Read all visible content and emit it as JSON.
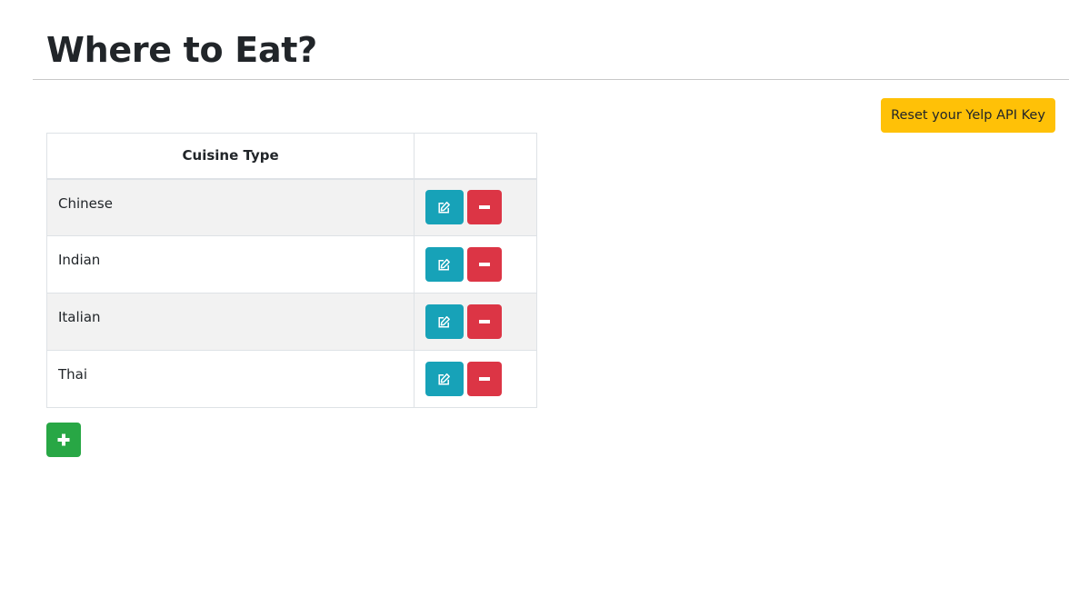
{
  "header": {
    "title": "Where to Eat?"
  },
  "toolbar": {
    "reset_label": "Reset your Yelp API Key"
  },
  "table": {
    "columns": [
      "Cuisine Type",
      ""
    ],
    "rows": [
      {
        "name": "Chinese"
      },
      {
        "name": "Indian"
      },
      {
        "name": "Italian"
      },
      {
        "name": "Thai"
      }
    ]
  },
  "icons": {
    "edit": "edit-icon",
    "delete": "minus-icon",
    "add": "plus-icon"
  },
  "colors": {
    "reset_button": "#ffc107",
    "edit_button": "#17a2b8",
    "delete_button": "#dc3545",
    "add_button": "#28a745"
  }
}
